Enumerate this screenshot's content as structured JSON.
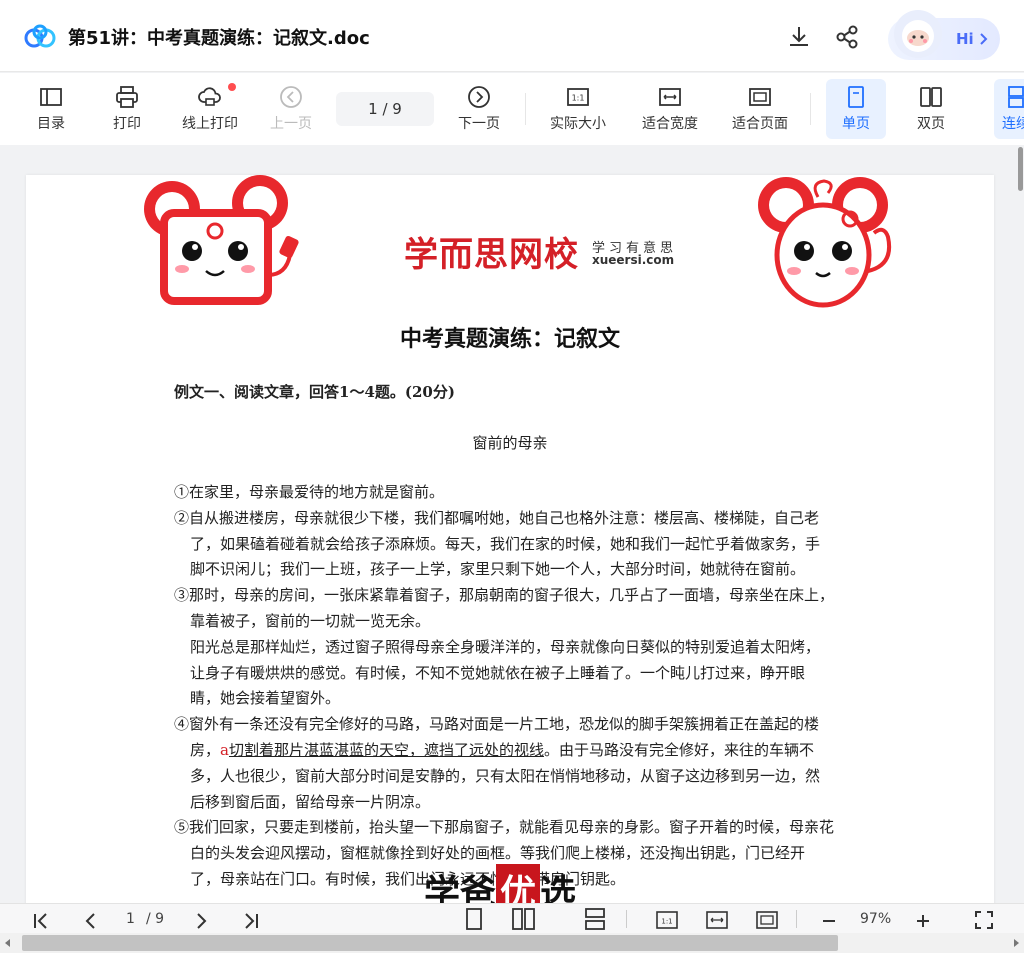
{
  "titlebar": {
    "doc_title": "第51讲：中考真题演练：记叙文.doc",
    "assistant_label": "Hi",
    "icons": [
      "download-icon",
      "share-icon",
      "chevron-right-icon"
    ]
  },
  "toolbar": {
    "toc": "目录",
    "print": "打印",
    "online_print": "线上打印",
    "prev": "上一页",
    "page_indicator": "1  /  9",
    "next": "下一页",
    "actual_size": "实际大小",
    "fit_width": "适合宽度",
    "fit_page": "适合页面",
    "single_page": "单页",
    "double_page": "双页",
    "continuous": "连续"
  },
  "document": {
    "brand": "学而思网校",
    "brand_tagline": "学习有意思",
    "brand_url": "xueersi.com",
    "heading": "中考真题演练：记叙文",
    "section": "例文一、阅读文章，回答1～4题。(20分)",
    "essay_title": "窗前的母亲",
    "paragraphs": [
      {
        "text": "①在家里，母亲最爱待的地方就是窗前。"
      },
      {
        "text": "②自从搬进楼房，母亲就很少下楼，我们都嘱咐她，她自己也格外注意：楼层高、楼梯陡，自己老了，如果磕着碰着就会给孩子添麻烦。每天，我们在家的时候，她和我们一起忙乎着做家务，手脚不识闲儿；我们一上班，孩子一上学，家里只剩下她一个人，大部分时间，她就待在窗前。"
      },
      {
        "text": "③那时，母亲的房间，一张床紧靠着窗子，那扇朝南的窗子很大，几乎占了一面墙，母亲坐在床上，靠着被子，窗前的一切就一览无余。"
      },
      {
        "text": "阳光总是那样灿烂，透过窗子照得母亲全身暖洋洋的，母亲就像向日葵似的特别爱追着太阳烤，让身子有暖烘烘的感觉。有时候，不知不觉她就依在被子上睡着了。一个盹儿打过来，睁开眼睛，她会接着望窗外。"
      },
      {
        "text_before": "④窗外有一条还没有完全修好的马路，马路对面是一片工地，恐龙似的脚手架簇拥着正在盖起的楼房，",
        "marker": "a",
        "underlined": "切割着那片湛蓝湛蓝的天空，遮挡了远处的视线",
        "text_after": "。由于马路没有完全修好，来往的车辆不多，人也很少，窗前大部分时间是安静的，只有太阳在悄悄地移动，从窗子这边移到另一边，然后移到窗后面，留给母亲一片阴凉。"
      },
      {
        "text": "⑤我们回家，只要走到楼前，抬头望一下那扇窗子，就能看见母亲的身影。窗子开着的时候，母亲花白的头发会迎风摆动，窗框就像拴到好处的画框。等我们爬上楼梯，还没掏出钥匙，门已经开了，母亲站在门口。有时候，我们出门永远不怕忘记带房门钥匙。"
      }
    ]
  },
  "bottombar": {
    "page_current": "1",
    "page_total": "/ 9",
    "zoom": "97%"
  },
  "watermark": {
    "part1": "学爸",
    "part2": "优",
    "part3": "选"
  }
}
